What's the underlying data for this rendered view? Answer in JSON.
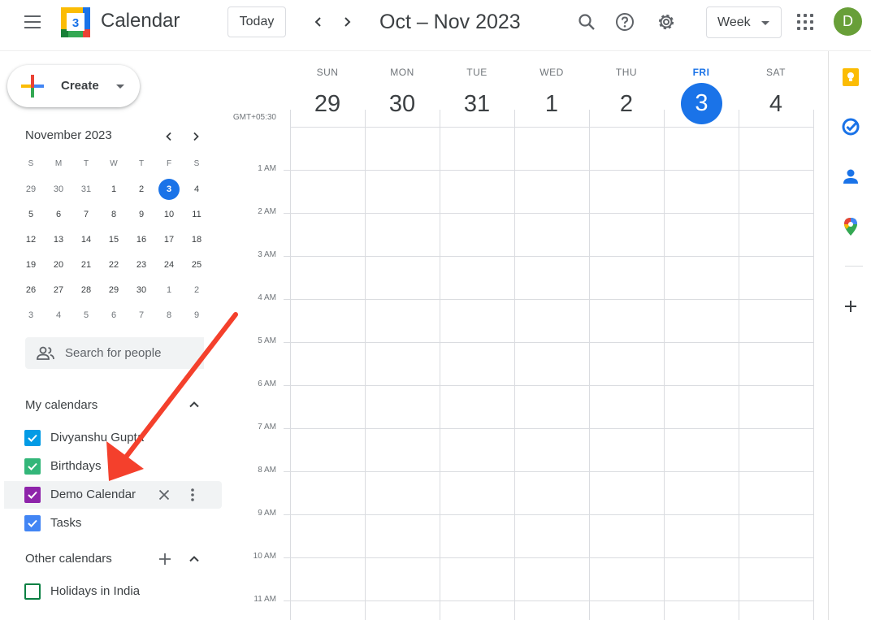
{
  "header": {
    "app_title": "Calendar",
    "logo_day": "3",
    "today_label": "Today",
    "period_title": "Oct – Nov 2023",
    "view_selected": "Week",
    "avatar_letter": "D"
  },
  "sidebar": {
    "create_label": "Create",
    "mini_calendar": {
      "title": "November 2023",
      "dow": [
        "S",
        "M",
        "T",
        "W",
        "T",
        "F",
        "S"
      ],
      "weeks": [
        [
          "29",
          "30",
          "31",
          "1",
          "2",
          "3",
          "4"
        ],
        [
          "5",
          "6",
          "7",
          "8",
          "9",
          "10",
          "11"
        ],
        [
          "12",
          "13",
          "14",
          "15",
          "16",
          "17",
          "18"
        ],
        [
          "19",
          "20",
          "21",
          "22",
          "23",
          "24",
          "25"
        ],
        [
          "26",
          "27",
          "28",
          "29",
          "30",
          "1",
          "2"
        ],
        [
          "3",
          "4",
          "5",
          "6",
          "7",
          "8",
          "9"
        ]
      ]
    },
    "people_search_placeholder": "Search for people",
    "my_calendars_title": "My calendars",
    "my_calendars": [
      {
        "name": "Divyanshu Gupta",
        "color": "#039be5",
        "checked": true
      },
      {
        "name": "Birthdays",
        "color": "#33b679",
        "checked": true
      },
      {
        "name": "Demo Calendar",
        "color": "#8e24aa",
        "checked": true
      },
      {
        "name": "Tasks",
        "color": "#4285f4",
        "checked": true
      }
    ],
    "other_calendars_title": "Other calendars",
    "other_calendars": [
      {
        "name": "Holidays in India",
        "color": "#0b8043",
        "checked": false
      }
    ]
  },
  "week": {
    "timezone": "GMT+05:30",
    "days": [
      {
        "dow": "SUN",
        "num": "29"
      },
      {
        "dow": "MON",
        "num": "30"
      },
      {
        "dow": "TUE",
        "num": "31"
      },
      {
        "dow": "WED",
        "num": "1"
      },
      {
        "dow": "THU",
        "num": "2"
      },
      {
        "dow": "FRI",
        "num": "3"
      },
      {
        "dow": "SAT",
        "num": "4"
      }
    ],
    "hours": [
      "1 AM",
      "2 AM",
      "3 AM",
      "4 AM",
      "5 AM",
      "6 AM",
      "7 AM",
      "8 AM",
      "9 AM",
      "10 AM",
      "11 AM"
    ]
  },
  "colors": {
    "accent": "#1a73e8",
    "annotation_arrow": "#f4402c"
  }
}
